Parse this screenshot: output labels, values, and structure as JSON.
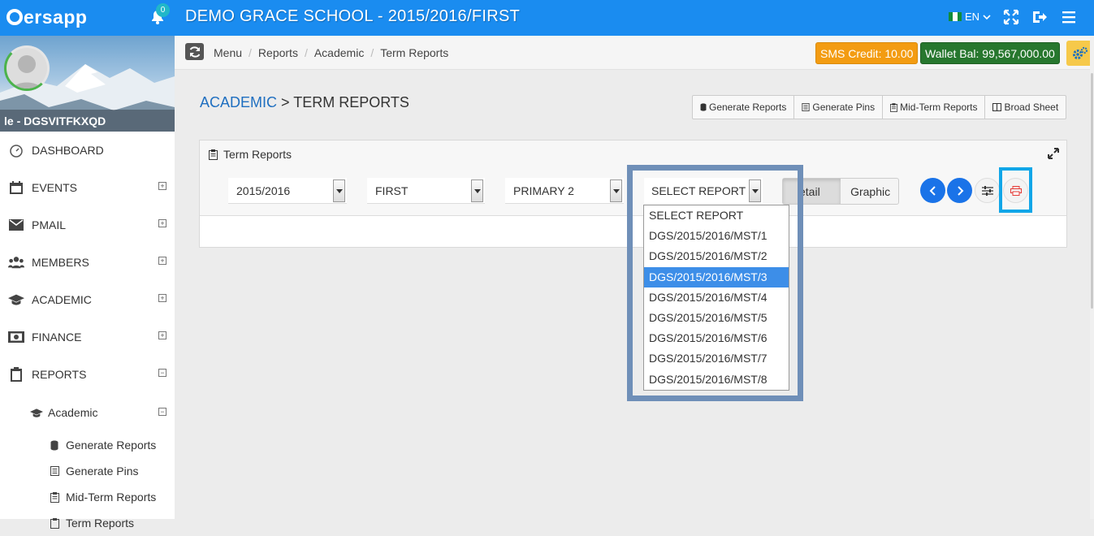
{
  "topbar": {
    "logo": "nersapp",
    "notification_count": "0",
    "school_title": "DEMO GRACE SCHOOL - 2015/2016/FIRST",
    "language": "EN",
    "colors": {
      "bar": "#1a8cf0"
    }
  },
  "sidebar": {
    "username": "le - DGSVITFKXQD",
    "items": [
      {
        "label": "DASHBOARD",
        "icon": "dashboard-icon",
        "expandable": false
      },
      {
        "label": "EVENTS",
        "icon": "calendar-icon",
        "expandable": true,
        "state": "+"
      },
      {
        "label": "PMAIL",
        "icon": "envelope-icon",
        "expandable": true,
        "state": "+"
      },
      {
        "label": "MEMBERS",
        "icon": "users-icon",
        "expandable": true,
        "state": "+"
      },
      {
        "label": "ACADEMIC",
        "icon": "graduation-cap-icon",
        "expandable": true,
        "state": "+"
      },
      {
        "label": "FINANCE",
        "icon": "money-icon",
        "expandable": true,
        "state": "+"
      },
      {
        "label": "REPORTS",
        "icon": "clipboard-icon",
        "expandable": true,
        "state": "−"
      }
    ],
    "reports_sub": {
      "label": "Academic",
      "state": "−",
      "items": [
        "Generate Reports",
        "Generate Pins",
        "Mid-Term Reports",
        "Term Reports"
      ]
    }
  },
  "breadcrumb": {
    "items": [
      "Menu",
      "Reports",
      "Academic",
      "Term Reports"
    ],
    "sms_credit": "SMS Credit: 10.00",
    "wallet_bal": "Wallet Bal: 99,567,000.00"
  },
  "page": {
    "title_link": "ACADEMIC",
    "title_rest": " > TERM REPORTS",
    "actions": [
      "Generate Reports",
      "Generate Pins",
      "Mid-Term Reports",
      "Broad Sheet"
    ]
  },
  "panel": {
    "title": "Term Reports",
    "session": "2015/2016",
    "term": "FIRST",
    "class": "PRIMARY 2",
    "report_select": "SELECT REPORT",
    "view_toggle": [
      "Detail",
      "Graphic"
    ],
    "view_toggle_visible": [
      "etail",
      "Graphic"
    ]
  },
  "dropdown": {
    "options": [
      "SELECT REPORT",
      "DGS/2015/2016/MST/1",
      "DGS/2015/2016/MST/2",
      "DGS/2015/2016/MST/3",
      "DGS/2015/2016/MST/4",
      "DGS/2015/2016/MST/5",
      "DGS/2015/2016/MST/6",
      "DGS/2015/2016/MST/7",
      "DGS/2015/2016/MST/8"
    ],
    "highlighted": "DGS/2015/2016/MST/3"
  }
}
